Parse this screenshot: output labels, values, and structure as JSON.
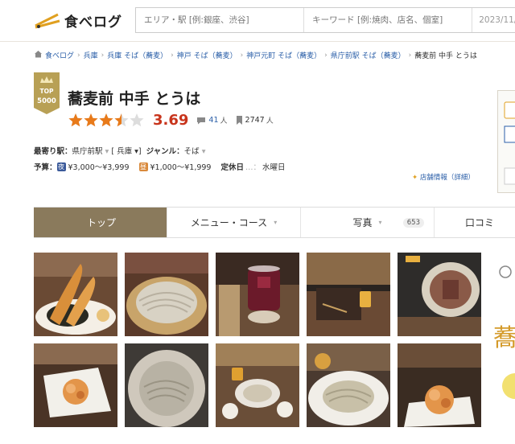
{
  "header": {
    "logo_text": "食べログ",
    "search_area_placeholder": "エリア・駅 [例:銀座、渋谷]",
    "search_keyword_placeholder": "キーワード [例:焼肉、店名、個室]",
    "search_date": "2023/11/"
  },
  "breadcrumb": [
    "食べログ",
    "兵庫",
    "兵庫 そば（蕎麦）",
    "神戸 そば（蕎麦）",
    "神戸元町 そば（蕎麦）",
    "県庁前駅 そば（蕎麦）",
    "蕎麦前 中手 とうは"
  ],
  "badge": {
    "top": "TOP",
    "num": "5000"
  },
  "restaurant": {
    "name": "蕎麦前 中手 とうは",
    "score": "3.69",
    "stars": 3.5,
    "reviews": "41",
    "reviews_unit": "人",
    "bookmarks": "2747",
    "bookmarks_unit": "人"
  },
  "info": {
    "station_label": "最寄り駅：",
    "station": "県庁前駅",
    "area": "兵庫",
    "genre_label": "ジャンル：",
    "genre": "そば",
    "budget_label": "予算：",
    "dinner_icon": "夜",
    "dinner_budget": "¥3,000～¥3,999",
    "lunch_icon": "昼",
    "lunch_budget": "¥1,000～¥1,999",
    "holiday_label": "定休日",
    "holiday": "水曜日",
    "store_info": "店舗情報（詳細）"
  },
  "tabs": [
    {
      "label": "トップ",
      "active": true
    },
    {
      "label": "メニュー・コース"
    },
    {
      "label": "写真",
      "count": "653"
    },
    {
      "label": "口コミ"
    }
  ],
  "photos": [
    {
      "name": "tempura-shrimp",
      "plate": "#f4efe6"
    },
    {
      "name": "zaru-soba-bamboo",
      "plate": "#e8dcc4"
    },
    {
      "name": "red-drink-glass",
      "plate": "#6b1a2a"
    },
    {
      "name": "counter-interior",
      "plate": "#8a6a44"
    },
    {
      "name": "duck-slices-plate",
      "plate": "#d8d0c0"
    },
    {
      "name": "kakiage-small",
      "plate": "#f2f0ea"
    },
    {
      "name": "soba-round-plate",
      "plate": "#cfc8bc"
    },
    {
      "name": "table-set-soba",
      "plate": "#e9e4dc"
    },
    {
      "name": "soba-white-plate",
      "plate": "#f1eee8"
    },
    {
      "name": "kakiage-dark",
      "plate": "#3a2c22"
    }
  ],
  "colors": {
    "active_tab": "#8a7a5c",
    "score": "#c8341c",
    "link": "#2b5fa8",
    "star": "#e87a1a"
  }
}
